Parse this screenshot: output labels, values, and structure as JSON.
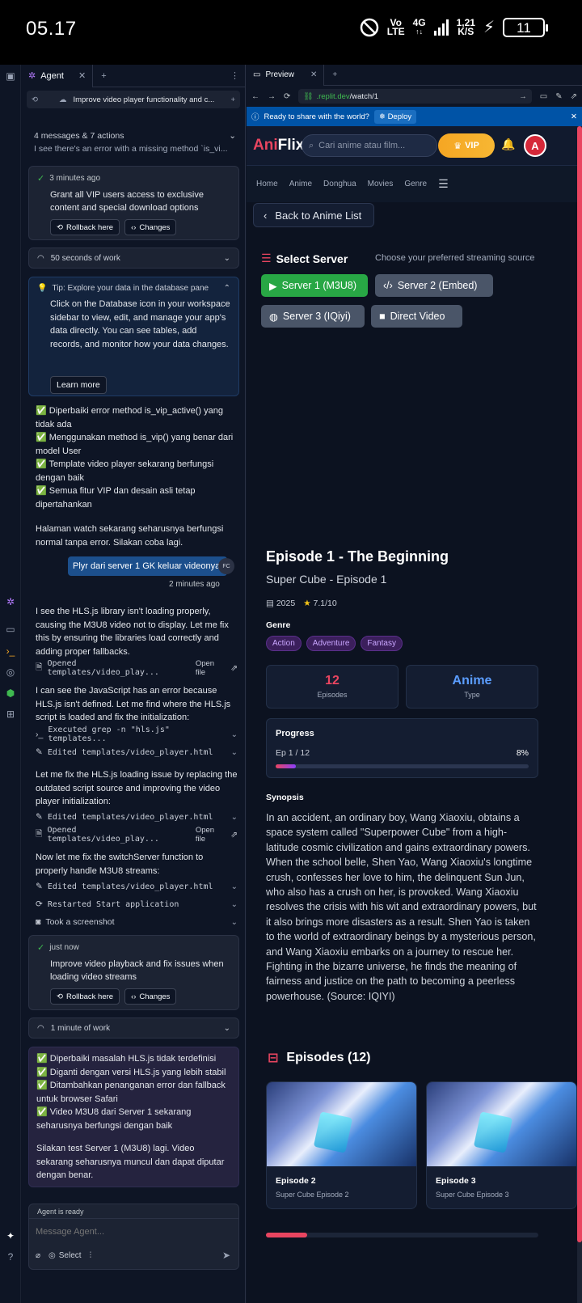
{
  "status_bar": {
    "time": "05.17",
    "network_top": "Vo",
    "network_bottom": "LTE",
    "signal": "4G",
    "speed_top": "1,21",
    "speed_bottom": "K/S",
    "battery": "11"
  },
  "agent": {
    "tab_label": "Agent",
    "thread_title": "Improve video player functionality and c...",
    "summary_title": "4 messages & 7 actions",
    "summary_preview": "I see there's an error with a missing method `is_vi...",
    "checkpoint1": {
      "time": "3 minutes ago",
      "text": "Grant all VIP users access to exclusive content and special download options",
      "rollback": "Rollback here",
      "changes": "Changes"
    },
    "work1": "50 seconds of work",
    "tip": {
      "title": "Tip: Explore your data in the database pane",
      "body": "Click on the Database icon in your workspace sidebar to view, edit, and manage your app's data directly. You can see tables, add records, and monitor how your data changes.",
      "button": "Learn more"
    },
    "msg1_lines": [
      "✅ Diperbaiki error method is_vip_active() yang tidak ada",
      "✅ Menggunakan method is_vip() yang benar dari model User",
      "✅ Template video player sekarang berfungsi dengan baik",
      "✅ Semua fitur VIP dan desain asli tetap dipertahankan"
    ],
    "msg1_footer": "Halaman watch sekarang seharusnya berfungsi normal tanpa error. Silakan coba lagi.",
    "user_msg": "Plyr dari server 1 GK keluar videonya.",
    "user_initials": "FC",
    "user_time": "2 minutes ago",
    "msg2": "I see the HLS.js library isn't loading properly, causing the M3U8 video not to display. Let me fix this by ensuring the libraries load correctly and adding proper fallbacks.",
    "act1": "Opened templates/video_play...",
    "open_file": "Open file",
    "msg3": "I can see the JavaScript has an error because HLS.js isn't defined. Let me find where the HLS.js script is loaded and fix the initialization:",
    "act2": "Executed grep -n \"hls.js\" templates...",
    "act3": "Edited templates/video_player.html",
    "msg4": "Let me fix the HLS.js loading issue by replacing the outdated script source and improving the video player initialization:",
    "act4": "Edited templates/video_player.html",
    "act5": "Opened templates/video_play...",
    "msg5": "Now let me fix the switchServer function to properly handle M3U8 streams:",
    "act6": "Edited templates/video_player.html",
    "act7": "Restarted Start application",
    "act8": "Took a screenshot",
    "checkpoint2": {
      "time": "just now",
      "text": "Improve video playback and fix issues when loading video streams",
      "rollback": "Rollback here",
      "changes": "Changes"
    },
    "work2": "1 minute of work",
    "msg6_lines": [
      "✅ Diperbaiki masalah HLS.js tidak terdefinisi",
      "✅ Diganti dengan versi HLS.js yang lebih stabil",
      "✅ Ditambahkan penanganan error dan fallback untuk browser Safari",
      "✅ Video M3U8 dari Server 1 sekarang seharusnya berfungsi dengan baik"
    ],
    "msg6_footer": "Silakan test Server 1 (M3U8) lagi. Video sekarang seharusnya muncul dan dapat diputar dengan benar.",
    "ready": "Agent is ready",
    "input_placeholder": "Message Agent...",
    "select_label": "Select"
  },
  "preview": {
    "tab_label": "Preview",
    "url_prefix": ".replit.dev",
    "url_path": "/watch/1",
    "banner_text": "Ready to share with the world?",
    "deploy_label": "Deploy"
  },
  "site": {
    "logo_a": "Ani",
    "logo_b": "Flix",
    "search_placeholder": "Cari anime atau film...",
    "vip": "VIP",
    "avatar": "A",
    "nav": [
      "Home",
      "Anime",
      "Donghua",
      "Movies",
      "Genre"
    ],
    "back": "Back to Anime List",
    "select_server": "Select Server",
    "server_hint": "Choose your preferred streaming source",
    "servers": [
      "Server 1 (M3U8)",
      "Server 2 (Embed)",
      "Server 3 (IQiyi)",
      "Direct Video"
    ],
    "episode_title": "Episode 1 - The Beginning",
    "subtitle": "Super Cube - Episode 1",
    "year": "2025",
    "rating": "7.1/10",
    "genre_label": "Genre",
    "genres": [
      "Action",
      "Adventure",
      "Fantasy"
    ],
    "episodes_count": "12",
    "episodes_label": "Episodes",
    "type_value": "Anime",
    "type_label": "Type",
    "progress_label": "Progress",
    "progress_text": "Ep 1 / 12",
    "progress_pct": "8%",
    "progress_value": 0.08,
    "synopsis_label": "Synopsis",
    "synopsis": "In an accident, an ordinary boy, Wang Xiaoxiu, obtains a space system called \"Superpower Cube\" from a high-latitude cosmic civilization and gains extraordinary powers. When the school belle, Shen Yao, Wang Xiaoxiu's longtime crush, confesses her love to him, the delinquent Sun Jun, who also has a crush on her, is provoked. Wang Xiaoxiu resolves the crisis with his wit and extraordinary powers, but it also brings more disasters as a result. Shen Yao is taken to the world of extraordinary beings by a mysterious person, and Wang Xiaoxiu embarks on a journey to rescue her. Fighting in the bizarre universe, he finds the meaning of fairness and justice on the path to becoming a peerless powerhouse. (Source: IQIYI)",
    "episodes_header": "Episodes (12)",
    "ep_cards": [
      {
        "title": "Episode 2",
        "sub": "Super Cube Episode 2"
      },
      {
        "title": "Episode 3",
        "sub": "Super Cube Episode 3"
      }
    ],
    "carousel_scroll": 0.15
  },
  "colors": {
    "accent": "#e94560",
    "green": "#28a745",
    "vip": "#f5a623",
    "replit_blue": "#0053a6"
  }
}
